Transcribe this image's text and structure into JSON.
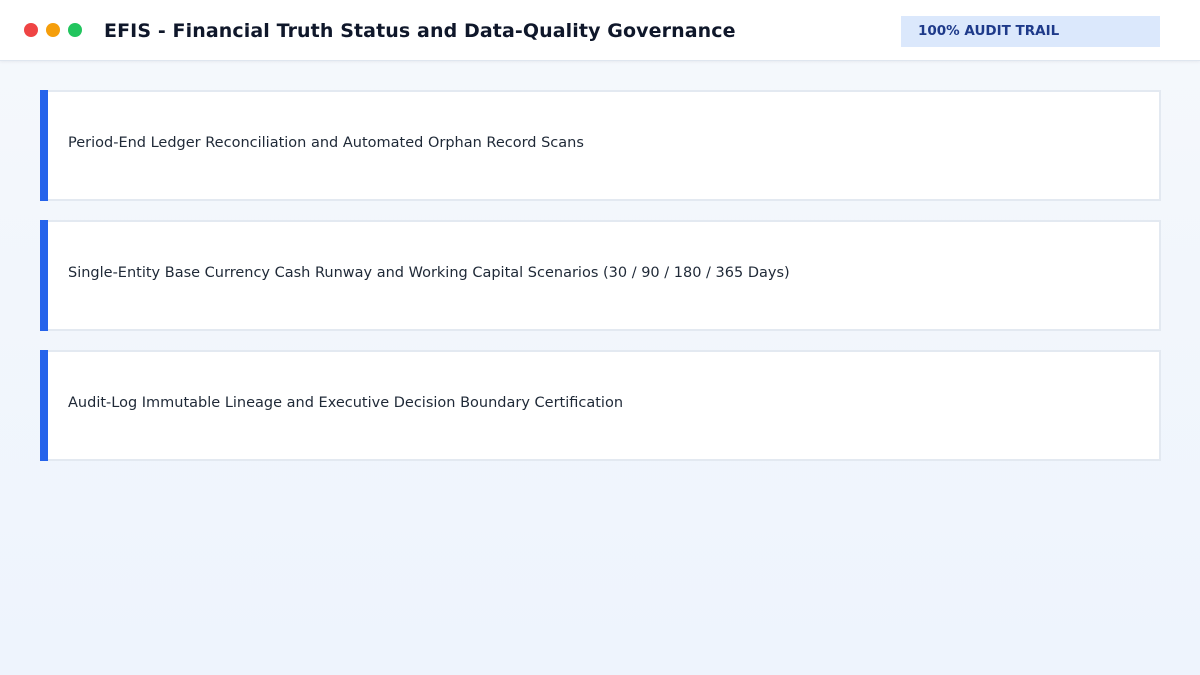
{
  "window": {
    "controls": [
      "close",
      "minimize",
      "maximize"
    ],
    "control_colors": {
      "close": "#ef4444",
      "minimize": "#f59e0b",
      "maximize": "#22c55e"
    },
    "title": "EFIS - Financial Truth Status and Data-Quality Governance",
    "badge": "100% AUDIT TRAIL"
  },
  "theme": {
    "accent": "#2563eb",
    "badge_bg": "#dbe8fc",
    "badge_text": "#1e3a8a"
  },
  "panels": [
    {
      "label": "Period-End Ledger Reconciliation and Automated Orphan Record Scans"
    },
    {
      "label": "Single-Entity Base Currency Cash Runway and Working Capital Scenarios (30 / 90 / 180 / 365 Days)"
    },
    {
      "label": "Audit-Log Immutable Lineage and Executive Decision Boundary Certification"
    }
  ]
}
